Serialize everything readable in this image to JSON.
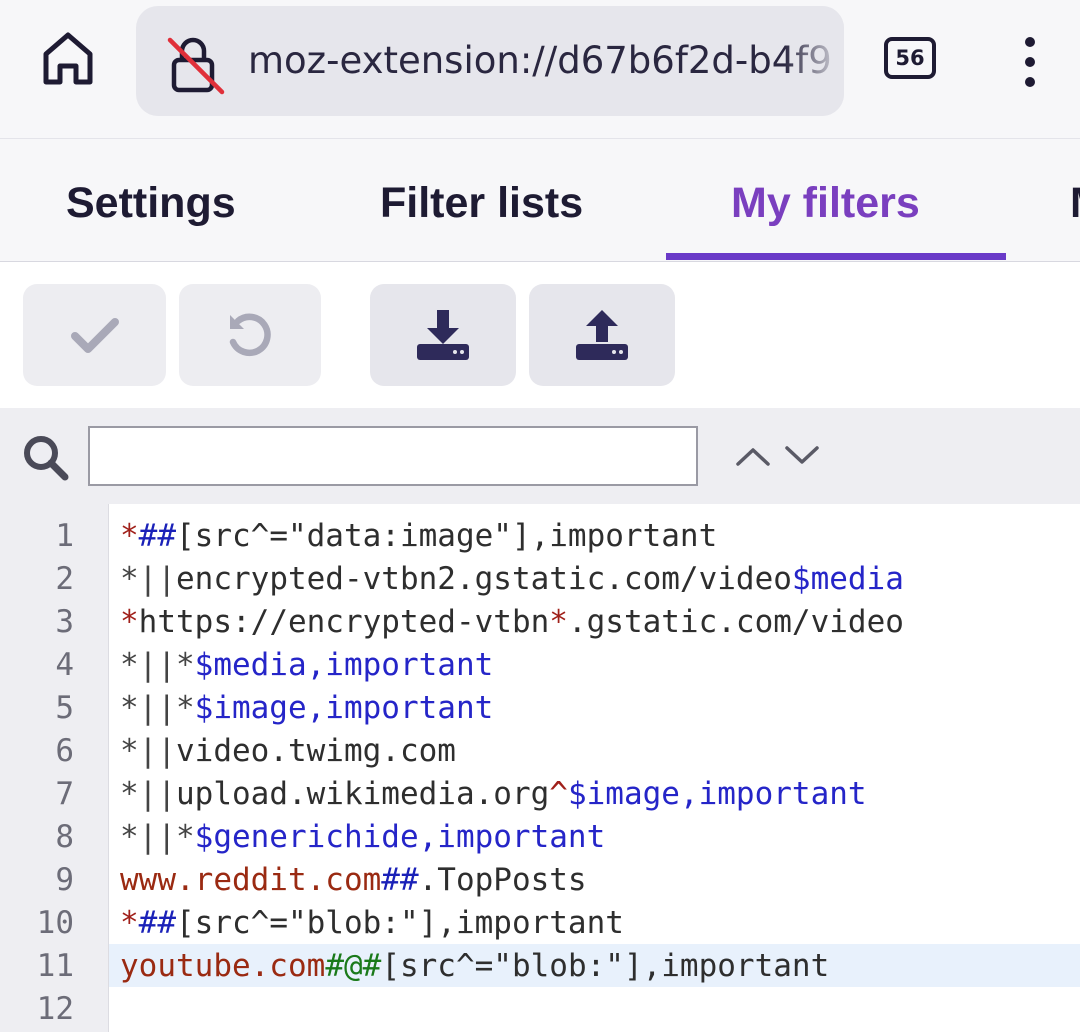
{
  "browser": {
    "url": "moz-extension://d67b6f2d-b4f9",
    "tab_count": "56",
    "icons": {
      "home": "home-icon",
      "lock": "insecure-lock-icon",
      "menu": "kebab-menu-icon"
    }
  },
  "tabs": [
    {
      "label": "Settings"
    },
    {
      "label": "Filter lists"
    },
    {
      "label": "My filters",
      "active": true
    },
    {
      "label": "M"
    }
  ],
  "toolbar": {
    "buttons": [
      {
        "name": "apply-changes",
        "icon": "checkmark-icon",
        "disabled": true
      },
      {
        "name": "revert-changes",
        "icon": "undo-icon",
        "disabled": true
      },
      {
        "name": "import",
        "icon": "download-icon",
        "disabled": false
      },
      {
        "name": "export",
        "icon": "upload-icon",
        "disabled": false
      }
    ]
  },
  "find": {
    "value": "",
    "placeholder": "",
    "icons": {
      "search": "search-icon",
      "prev": "chevron-up-icon",
      "next": "chevron-down-icon"
    }
  },
  "colors": {
    "accent": "#7a3fbf",
    "underline": "#6a3ac8",
    "active_line": "#e8f1fc"
  },
  "editor": {
    "line_numbers": [
      "1",
      "2",
      "3",
      "4",
      "5",
      "6",
      "7",
      "8",
      "9",
      "10",
      "11",
      "12"
    ],
    "active_line": 11,
    "lines": [
      [
        {
          "t": "*",
          "c": "star"
        },
        {
          "t": "##",
          "c": "sep"
        },
        {
          "t": "[src^=\"data:image\"],important",
          "c": "txt"
        }
      ],
      [
        {
          "t": "*||",
          "c": "pipe"
        },
        {
          "t": "encrypted-vtbn2.gstatic.com/video",
          "c": "txt"
        },
        {
          "t": "$media",
          "c": "opt"
        }
      ],
      [
        {
          "t": "*",
          "c": "star"
        },
        {
          "t": "https://encrypted-vtbn",
          "c": "txt"
        },
        {
          "t": "*",
          "c": "star"
        },
        {
          "t": ".gstatic.com/video",
          "c": "txt"
        }
      ],
      [
        {
          "t": "*||*",
          "c": "pipe"
        },
        {
          "t": "$media,important",
          "c": "opt"
        }
      ],
      [
        {
          "t": "*||*",
          "c": "pipe"
        },
        {
          "t": "$image,important",
          "c": "opt"
        }
      ],
      [
        {
          "t": "*||",
          "c": "pipe"
        },
        {
          "t": "video.twimg.com",
          "c": "txt"
        }
      ],
      [
        {
          "t": "*||",
          "c": "pipe"
        },
        {
          "t": "upload.wikimedia.org",
          "c": "txt"
        },
        {
          "t": "^",
          "c": "star"
        },
        {
          "t": "$image,important",
          "c": "opt"
        }
      ],
      [
        {
          "t": "*||*",
          "c": "pipe"
        },
        {
          "t": "$generichide,important",
          "c": "opt"
        }
      ],
      [
        {
          "t": "www.reddit.com",
          "c": "dom"
        },
        {
          "t": "##",
          "c": "sep"
        },
        {
          "t": ".TopPosts",
          "c": "txt"
        }
      ],
      [
        {
          "t": "*",
          "c": "star"
        },
        {
          "t": "##",
          "c": "sep"
        },
        {
          "t": "[src^=\"blob:\"],important",
          "c": "txt"
        }
      ],
      [
        {
          "t": "youtube.com",
          "c": "dom"
        },
        {
          "t": "#@#",
          "c": "exc"
        },
        {
          "t": "[src^=\"blob:\"],important",
          "c": "txt"
        }
      ],
      []
    ]
  }
}
